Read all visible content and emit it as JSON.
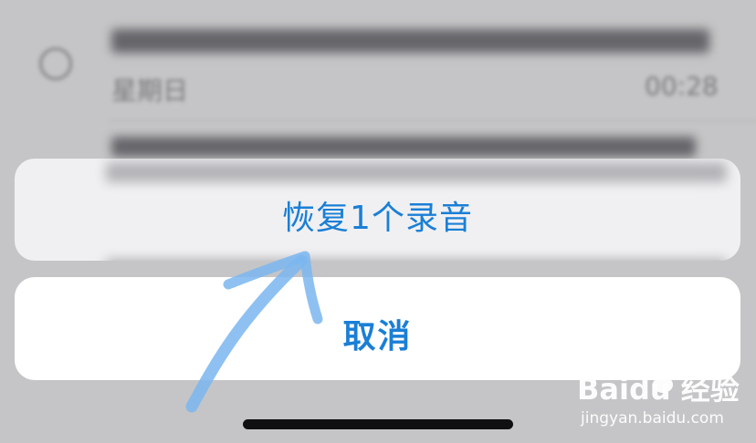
{
  "background": {
    "row": {
      "day": "星期日",
      "duration": "00:28"
    }
  },
  "sheet": {
    "action_label": "恢复1个录音",
    "cancel_label": "取消"
  },
  "watermark": {
    "brand": "Baidu 经验",
    "url": "jingyan.baidu.com"
  },
  "colors": {
    "accent": "#1a7fd6",
    "annotation_arrow": "#7ab6f0"
  }
}
